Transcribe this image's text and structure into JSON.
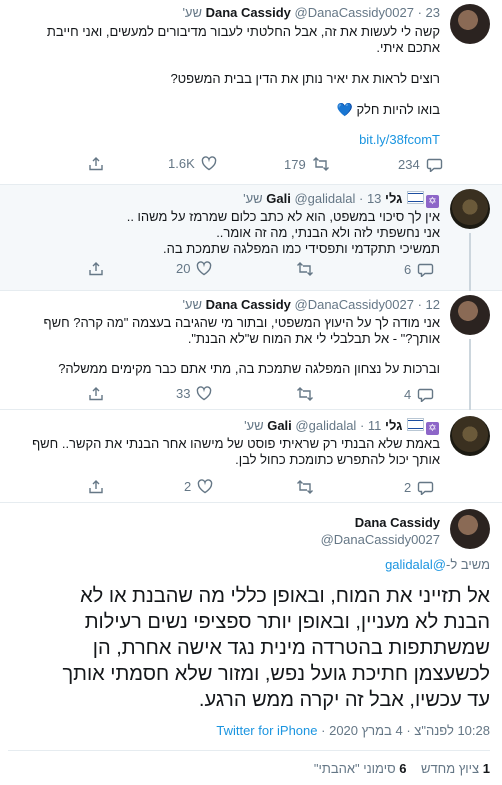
{
  "tweet1": {
    "name": "Dana Cassidy",
    "handle": "@DanaCassidy0027",
    "time": "23 שע'",
    "text_line1": "קשה לי לעשות את זה, אבל החלטתי לעבור מדיבורים למעשים, ואני חייבת",
    "text_line2": "אתכם איתי.",
    "text_line3": "רוצים לראות את יאיר נותן את הדין בבית המשפט?",
    "text_line4": "בואו להיות חלק",
    "heart": "💙",
    "link": "bit.ly/38fcomT",
    "replies": "234",
    "retweets": "179",
    "likes": "1.6K"
  },
  "tweet2": {
    "name": "Gali",
    "name_prefix": "גלי",
    "handle": "@galidalal",
    "time": "13 שע'",
    "text_line1": "אין לך סיכוי במשפט, הוא לא כתב כלום שמרמז על משהו ..",
    "text_line2": "אני נחשפתי לזה ולא הבנתי, מה זה אומר..",
    "text_line3": "תמשיכי תתקדמי ותפסידי כמו המפלגה שתמכת בה.",
    "replies": "6",
    "retweets": "",
    "likes": "20"
  },
  "tweet3": {
    "name": "Dana Cassidy",
    "handle": "@DanaCassidy0027",
    "time": "12 שע'",
    "text_line1": "אני מודה לך על היעוץ המשפטי, ובתור מי שהגיבה בעצמה \"מה קרה? חשף",
    "text_line2": "אותך?\" - אל תבלבלי לי את המוח ש\"לא הבנת\".",
    "text_line3": "וברכות על נצחון המפלגה שתמכת בה, מתי אתם כבר מקימים ממשלה?",
    "replies": "4",
    "retweets": "",
    "likes": "33"
  },
  "tweet4": {
    "name": "Gali",
    "name_prefix": "גלי",
    "handle": "@galidalal",
    "time": "11 שע'",
    "text_line1": "באמת שלא הבנתי רק שראיתי פוסט של מישהו אחר הבנתי את הקשר.. חשף",
    "text_line2": "אותך יכול להתפרש כתומכת כחול לבן.",
    "replies": "2",
    "retweets": "",
    "likes": "2"
  },
  "main": {
    "name": "Dana Cassidy",
    "handle": "@DanaCassidy0027",
    "reply_label": "משיב ל-",
    "reply_to": "@galidalal",
    "text_line1": "אל תזייני את המוח, ובאופן כללי מה שהבנת או לא",
    "text_line2": "הבנת לא מעניין, ובאופן יותר ספציפי נשים רעילות",
    "text_line3": "שמשתתפות בהטרדה מינית נגד אישה אחרת, הן",
    "text_line4": "לכשעצמן חתיכת גועל נפש, ומזור שלא חסמתי אותך",
    "text_line5": "עד עכשיו, אבל זה יקרה ממש הרגע.",
    "time": "10:28 לפנה\"צ",
    "date": "4 במרץ 2020",
    "source": "Twitter for iPhone",
    "dot": "·"
  },
  "stats": {
    "retweet_count": "1",
    "retweet_label": "ציוץ מחדש",
    "like_count": "6",
    "like_label": "סימוני \"אהבתי\""
  }
}
